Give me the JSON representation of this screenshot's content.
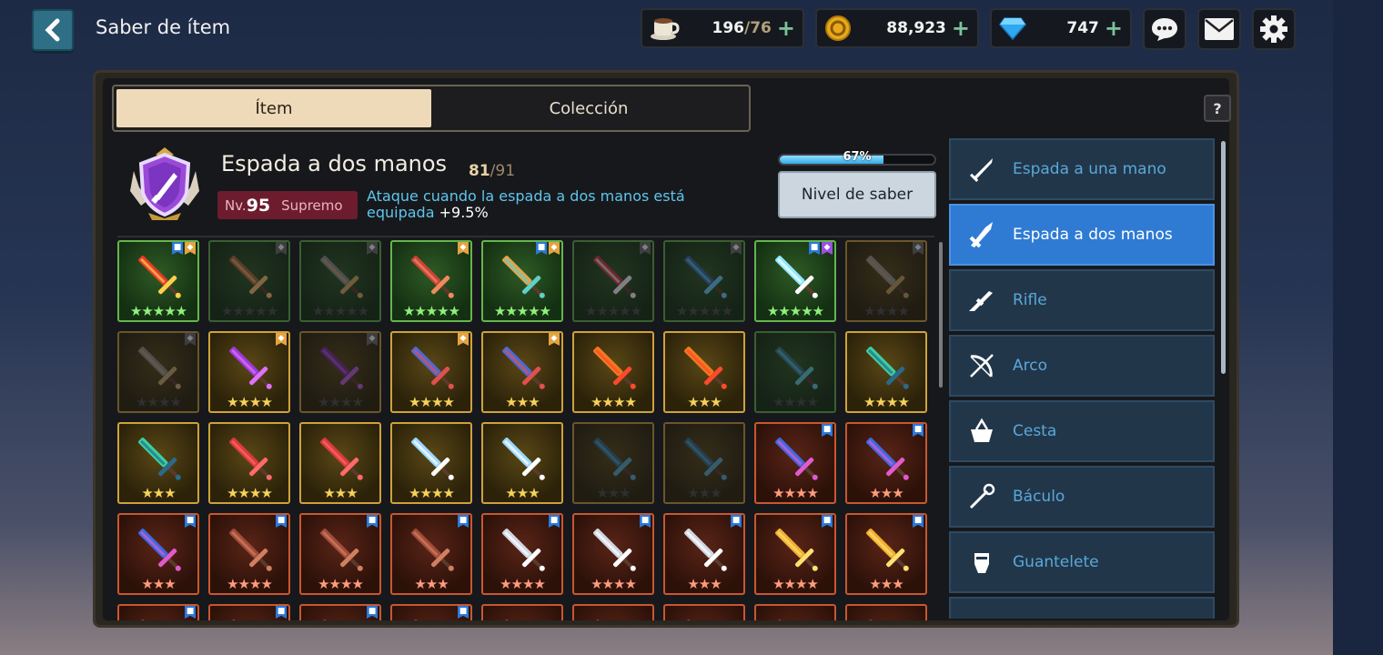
{
  "header": {
    "title": "Saber de ítem",
    "coffee": {
      "value": "196",
      "max": "/76"
    },
    "gold": {
      "value": "88,923"
    },
    "gems": {
      "value": "747"
    },
    "plus": "+"
  },
  "tabs": [
    {
      "label": "Ítem",
      "active": true
    },
    {
      "label": "Colección",
      "active": false
    }
  ],
  "help": "?",
  "info": {
    "title": "Espada a dos manos",
    "count": "81",
    "count_max": "/91",
    "level_prefix": "Nv.",
    "level": "95",
    "rank": "Supremo",
    "effect_text": "Ataque cuando la espada a dos manos está equipada",
    "effect_value": "+9.5%",
    "progress_label": "67%",
    "progress": 0.67,
    "button": "Nivel de saber"
  },
  "categories": [
    {
      "label": "Espada a una mano",
      "icon": "sword-icon",
      "active": false
    },
    {
      "label": "Espada a dos manos",
      "icon": "greatsword-icon",
      "active": true
    },
    {
      "label": "Rifle",
      "icon": "rifle-icon",
      "active": false
    },
    {
      "label": "Arco",
      "icon": "bow-icon",
      "active": false
    },
    {
      "label": "Cesta",
      "icon": "basket-icon",
      "active": false
    },
    {
      "label": "Báculo",
      "icon": "staff-icon",
      "active": false
    },
    {
      "label": "Guantelete",
      "icon": "gauntlet-icon",
      "active": false
    },
    {
      "label": "",
      "icon": "claw-icon",
      "active": false
    }
  ],
  "items": [
    {
      "rarity": "green",
      "stars": 5,
      "max": 5,
      "owned": true,
      "flags": [
        "blue",
        "orange"
      ],
      "color": "#e53b2b",
      "accent": "#ffcf4a"
    },
    {
      "rarity": "green",
      "stars": 0,
      "max": 5,
      "owned": false,
      "flags": [
        "grey"
      ],
      "color": "#b06a3a",
      "accent": "#ffc27a"
    },
    {
      "rarity": "green",
      "stars": 0,
      "max": 5,
      "owned": false,
      "flags": [
        "grey"
      ],
      "color": "#8a8f96",
      "accent": "#d9b060"
    },
    {
      "rarity": "green",
      "stars": 5,
      "max": 5,
      "owned": true,
      "flags": [
        "orange"
      ],
      "color": "#c9413a",
      "accent": "#f08a5a"
    },
    {
      "rarity": "green",
      "stars": 5,
      "max": 5,
      "owned": true,
      "flags": [
        "blue",
        "orange"
      ],
      "color": "#e2a34a",
      "accent": "#5fd0c8"
    },
    {
      "rarity": "green",
      "stars": 0,
      "max": 5,
      "owned": false,
      "flags": [
        "grey"
      ],
      "color": "#d03a44",
      "accent": "#ffffff"
    },
    {
      "rarity": "green",
      "stars": 0,
      "max": 5,
      "owned": false,
      "flags": [
        "grey"
      ],
      "color": "#3a6aa0",
      "accent": "#6ad0ff"
    },
    {
      "rarity": "green",
      "stars": 5,
      "max": 5,
      "owned": true,
      "flags": [
        "blue",
        "purple"
      ],
      "color": "#8fe8ff",
      "accent": "#ffffff"
    },
    {
      "rarity": "gold",
      "stars": 0,
      "max": 4,
      "owned": false,
      "flags": [
        "grey"
      ],
      "color": "#9a9a9a",
      "accent": "#c9a060"
    },
    {
      "rarity": "gold",
      "stars": 0,
      "max": 4,
      "owned": false,
      "flags": [
        "grey"
      ],
      "color": "#8f8f8f",
      "accent": "#d0b070"
    },
    {
      "rarity": "gold",
      "stars": 4,
      "max": 4,
      "owned": true,
      "flags": [
        "orange"
      ],
      "color": "#9b3ad8",
      "accent": "#e070ff"
    },
    {
      "rarity": "gold",
      "stars": 0,
      "max": 4,
      "owned": false,
      "flags": [
        "grey"
      ],
      "color": "#7a2fa0",
      "accent": "#c060e0"
    },
    {
      "rarity": "gold",
      "stars": 4,
      "max": 4,
      "owned": true,
      "flags": [
        "orange"
      ],
      "color": "#4a6ad8",
      "accent": "#e05050"
    },
    {
      "rarity": "gold",
      "stars": 3,
      "max": 3,
      "owned": true,
      "flags": [
        "orange"
      ],
      "color": "#4a6ad8",
      "accent": "#e05050"
    },
    {
      "rarity": "gold",
      "stars": 4,
      "max": 4,
      "owned": true,
      "flags": [],
      "color": "#f07a20",
      "accent": "#ff4a2a"
    },
    {
      "rarity": "gold",
      "stars": 3,
      "max": 3,
      "owned": true,
      "flags": [],
      "color": "#f07a20",
      "accent": "#ff4a2a"
    },
    {
      "rarity": "green",
      "stars": 0,
      "max": 4,
      "owned": false,
      "flags": [],
      "color": "#3a7a8a",
      "accent": "#60d0e0"
    },
    {
      "rarity": "gold",
      "stars": 4,
      "max": 4,
      "owned": true,
      "flags": [],
      "color": "#3ad0a0",
      "accent": "#2a6a8a"
    },
    {
      "rarity": "gold",
      "stars": 3,
      "max": 3,
      "owned": true,
      "flags": [],
      "color": "#3ad0a0",
      "accent": "#2a6a8a"
    },
    {
      "rarity": "gold",
      "stars": 4,
      "max": 4,
      "owned": true,
      "flags": [],
      "color": "#d63a3a",
      "accent": "#ff6a6a"
    },
    {
      "rarity": "gold",
      "stars": 3,
      "max": 3,
      "owned": true,
      "flags": [],
      "color": "#d63a3a",
      "accent": "#ff6a6a"
    },
    {
      "rarity": "gold",
      "stars": 4,
      "max": 4,
      "owned": true,
      "flags": [],
      "color": "#9ad8ff",
      "accent": "#ffffff"
    },
    {
      "rarity": "gold",
      "stars": 3,
      "max": 3,
      "owned": true,
      "flags": [],
      "color": "#9ad8ff",
      "accent": "#ffffff"
    },
    {
      "rarity": "gold",
      "stars": 0,
      "max": 3,
      "owned": false,
      "flags": [],
      "color": "#3a6a8a",
      "accent": "#5ab0d0"
    },
    {
      "rarity": "gold",
      "stars": 0,
      "max": 3,
      "owned": false,
      "flags": [],
      "color": "#3a6a8a",
      "accent": "#5ab0d0"
    },
    {
      "rarity": "red",
      "stars": 4,
      "max": 4,
      "owned": true,
      "flags": [
        "blue"
      ],
      "color": "#3a6ae0",
      "accent": "#e05ad0"
    },
    {
      "rarity": "red",
      "stars": 3,
      "max": 3,
      "owned": true,
      "flags": [
        "blue"
      ],
      "color": "#3a6ae0",
      "accent": "#e05ad0"
    },
    {
      "rarity": "red",
      "stars": 3,
      "max": 3,
      "owned": true,
      "flags": [
        "blue"
      ],
      "color": "#3a6ae0",
      "accent": "#e05ad0"
    },
    {
      "rarity": "red",
      "stars": 4,
      "max": 4,
      "owned": true,
      "flags": [
        "blue"
      ],
      "color": "#a04a3a",
      "accent": "#d08060"
    },
    {
      "rarity": "red",
      "stars": 4,
      "max": 4,
      "owned": true,
      "flags": [
        "blue"
      ],
      "color": "#a04a3a",
      "accent": "#d08060"
    },
    {
      "rarity": "red",
      "stars": 3,
      "max": 3,
      "owned": true,
      "flags": [
        "blue"
      ],
      "color": "#a04a3a",
      "accent": "#d08060"
    },
    {
      "rarity": "red",
      "stars": 4,
      "max": 4,
      "owned": true,
      "flags": [
        "blue"
      ],
      "color": "#d0d6e0",
      "accent": "#ffffff"
    },
    {
      "rarity": "red",
      "stars": 4,
      "max": 4,
      "owned": true,
      "flags": [
        "blue"
      ],
      "color": "#d0d6e0",
      "accent": "#ffffff"
    },
    {
      "rarity": "red",
      "stars": 3,
      "max": 3,
      "owned": true,
      "flags": [
        "blue"
      ],
      "color": "#d0d6e0",
      "accent": "#ffffff"
    },
    {
      "rarity": "red",
      "stars": 4,
      "max": 4,
      "owned": true,
      "flags": [
        "blue"
      ],
      "color": "#f0b030",
      "accent": "#ffe070"
    },
    {
      "rarity": "red",
      "stars": 3,
      "max": 3,
      "owned": true,
      "flags": [
        "blue"
      ],
      "color": "#f0b030",
      "accent": "#ffe070"
    },
    {
      "rarity": "red",
      "stars": 0,
      "max": 0,
      "owned": true,
      "flags": [
        "blue"
      ],
      "color": "#a04a3a",
      "accent": "#d08060"
    },
    {
      "rarity": "red",
      "stars": 0,
      "max": 0,
      "owned": true,
      "flags": [
        "blue"
      ],
      "color": "#a04a3a",
      "accent": "#d08060"
    },
    {
      "rarity": "red",
      "stars": 0,
      "max": 0,
      "owned": true,
      "flags": [
        "blue"
      ],
      "color": "#a04a3a",
      "accent": "#d08060"
    },
    {
      "rarity": "red",
      "stars": 0,
      "max": 0,
      "owned": true,
      "flags": [
        "blue"
      ],
      "color": "#a04a3a",
      "accent": "#d08060"
    },
    {
      "rarity": "red",
      "stars": 0,
      "max": 0,
      "owned": true,
      "flags": [],
      "color": "#a04a3a",
      "accent": "#d08060"
    },
    {
      "rarity": "red",
      "stars": 0,
      "max": 0,
      "owned": true,
      "flags": [],
      "color": "#a04a3a",
      "accent": "#d08060"
    },
    {
      "rarity": "red",
      "stars": 0,
      "max": 0,
      "owned": true,
      "flags": [],
      "color": "#a04a3a",
      "accent": "#d08060"
    },
    {
      "rarity": "red",
      "stars": 0,
      "max": 0,
      "owned": true,
      "flags": [],
      "color": "#a04a3a",
      "accent": "#d08060"
    },
    {
      "rarity": "red",
      "stars": 0,
      "max": 0,
      "owned": true,
      "flags": [],
      "color": "#a04a3a",
      "accent": "#d08060"
    }
  ]
}
